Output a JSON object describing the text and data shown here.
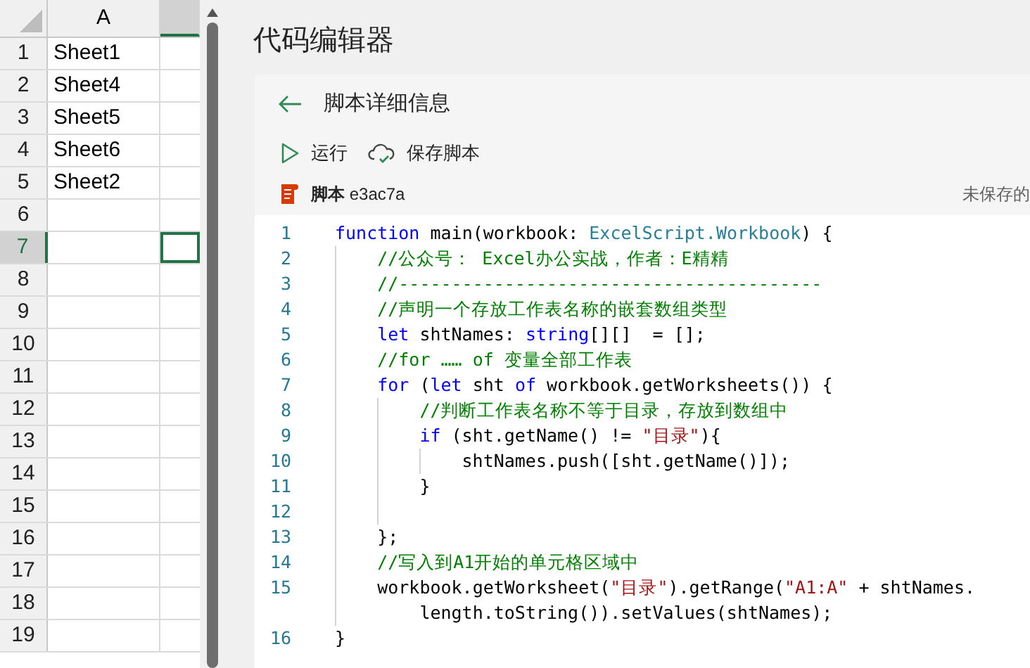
{
  "spreadsheet": {
    "columns": [
      {
        "label": "A",
        "selected": false
      },
      {
        "selected": true
      }
    ],
    "rows": [
      {
        "number": "1",
        "selected": false,
        "cells": [
          "Sheet1"
        ]
      },
      {
        "number": "2",
        "selected": false,
        "cells": [
          "Sheet4"
        ]
      },
      {
        "number": "3",
        "selected": false,
        "cells": [
          "Sheet5"
        ]
      },
      {
        "number": "4",
        "selected": false,
        "cells": [
          "Sheet6"
        ]
      },
      {
        "number": "5",
        "selected": false,
        "cells": [
          "Sheet2"
        ]
      },
      {
        "number": "6",
        "selected": false,
        "cells": []
      },
      {
        "number": "7",
        "selected": true,
        "cells": []
      },
      {
        "number": "8",
        "selected": false,
        "cells": []
      },
      {
        "number": "9",
        "selected": false,
        "cells": []
      },
      {
        "number": "10",
        "selected": false,
        "cells": []
      },
      {
        "number": "11",
        "selected": false,
        "cells": []
      },
      {
        "number": "12",
        "selected": false,
        "cells": []
      },
      {
        "number": "13",
        "selected": false,
        "cells": []
      },
      {
        "number": "14",
        "selected": false,
        "cells": []
      },
      {
        "number": "15",
        "selected": false,
        "cells": []
      },
      {
        "number": "16",
        "selected": false,
        "cells": []
      },
      {
        "number": "17",
        "selected": false,
        "cells": []
      },
      {
        "number": "18",
        "selected": false,
        "cells": []
      },
      {
        "number": "19",
        "selected": false,
        "cells": []
      }
    ]
  },
  "pane": {
    "title": "代码编辑器",
    "back_title": "脚本详细信息",
    "toolbar": [
      {
        "kind": "run",
        "label": "运行"
      },
      {
        "kind": "save",
        "label": "保存脚本"
      }
    ],
    "script": {
      "label": "脚本",
      "name": "e3ac7a",
      "status": "未保存的"
    },
    "code": [
      {
        "number": "1",
        "tokens": [
          {
            "kind": "keyword",
            "text": "function"
          },
          {
            "kind": "plain",
            "text": " main(workbook: "
          },
          {
            "kind": "type",
            "text": "ExcelScript.Workbook"
          },
          {
            "kind": "plain",
            "text": ") {"
          }
        ],
        "children": [
          {
            "number": "2",
            "tokens": [
              {
                "kind": "comment",
                "text": "//公众号： Excel办公实战，作者：E精精"
              }
            ]
          },
          {
            "number": "3",
            "tokens": [
              {
                "kind": "comment",
                "text": "//----------------------------------------"
              }
            ]
          },
          {
            "number": "4",
            "tokens": [
              {
                "kind": "comment",
                "text": "//声明一个存放工作表名称的嵌套数组类型"
              }
            ]
          },
          {
            "number": "5",
            "tokens": [
              {
                "kind": "keyword",
                "text": "let"
              },
              {
                "kind": "plain",
                "text": " shtNames: "
              },
              {
                "kind": "keyword",
                "text": "string"
              },
              {
                "kind": "plain",
                "text": "[][]  = [];"
              }
            ]
          },
          {
            "number": "6",
            "tokens": [
              {
                "kind": "comment",
                "text": "//for …… of 变量全部工作表"
              }
            ]
          },
          {
            "number": "7",
            "tokens": [
              {
                "kind": "keyword",
                "text": "for"
              },
              {
                "kind": "plain",
                "text": " ("
              },
              {
                "kind": "keyword",
                "text": "let"
              },
              {
                "kind": "plain",
                "text": " sht "
              },
              {
                "kind": "keyword",
                "text": "of"
              },
              {
                "kind": "plain",
                "text": " workbook.getWorksheets()) {"
              }
            ],
            "children": [
              {
                "number": "8",
                "tokens": [
                  {
                    "kind": "comment",
                    "text": "//判断工作表名称不等于目录，存放到数组中"
                  }
                ]
              },
              {
                "number": "9",
                "tokens": [
                  {
                    "kind": "keyword",
                    "text": "if"
                  },
                  {
                    "kind": "plain",
                    "text": " (sht.getName() != "
                  },
                  {
                    "kind": "string",
                    "text": "\"目录\""
                  },
                  {
                    "kind": "plain",
                    "text": "){"
                  }
                ],
                "children": [
                  {
                    "number": "10",
                    "tokens": [
                      {
                        "kind": "plain",
                        "text": "shtNames.push([sht.getName()]);"
                      }
                    ]
                  }
                ]
              },
              {
                "number": "11",
                "tokens": [
                  {
                    "kind": "plain",
                    "text": "}"
                  }
                ]
              },
              {
                "number": "12"
              }
            ]
          },
          {
            "number": "13",
            "tokens": [
              {
                "kind": "plain",
                "text": "};"
              }
            ]
          },
          {
            "number": "14",
            "tokens": [
              {
                "kind": "comment",
                "text": "//写入到A1开始的单元格区域中"
              }
            ]
          },
          {
            "number": "15",
            "tokens": [
              {
                "kind": "plain",
                "text": "workbook.getWorksheet("
              },
              {
                "kind": "string",
                "text": "\"目录\""
              },
              {
                "kind": "plain",
                "text": ").getRange("
              },
              {
                "kind": "string",
                "text": "\"A1:A\""
              },
              {
                "kind": "plain",
                "text": " + shtNames."
              },
              {
                "kind": "break"
              },
              {
                "kind": "plain",
                "text": "length.toString()).setValues(shtNames);"
              }
            ]
          }
        ]
      },
      {
        "number": "16",
        "tokens": [
          {
            "kind": "plain",
            "text": "}"
          }
        ]
      }
    ]
  }
}
